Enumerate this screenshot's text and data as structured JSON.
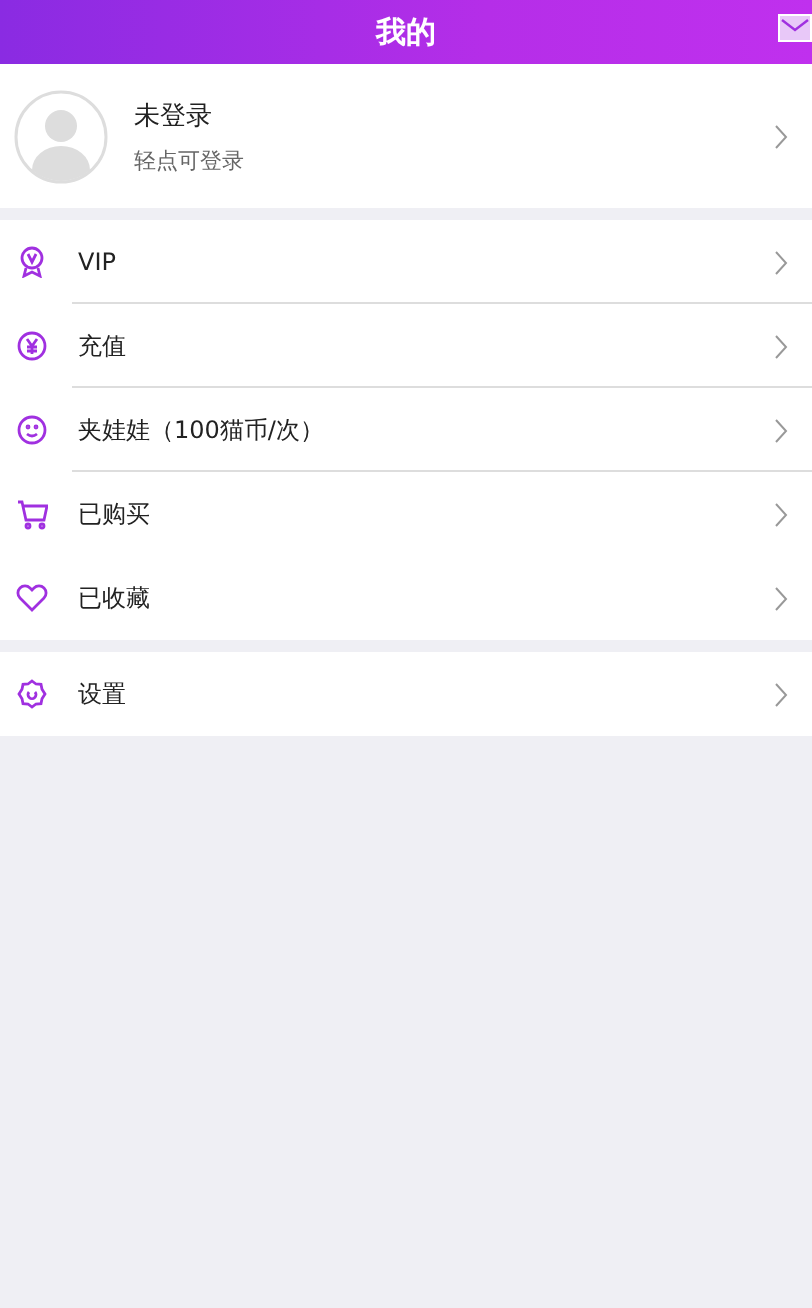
{
  "header": {
    "title": "我的"
  },
  "profile": {
    "name": "未登录",
    "hint": "轻点可登录"
  },
  "sections": [
    {
      "items": [
        {
          "label": "VIP",
          "kind": "vip",
          "divider": true
        },
        {
          "label": "充值",
          "kind": "coin",
          "divider": true
        },
        {
          "label": "夹娃娃（100猫币/次）",
          "kind": "face",
          "divider": true
        },
        {
          "label": "已购买",
          "kind": "cart",
          "divider": false
        },
        {
          "label": "已收藏",
          "kind": "heart",
          "divider": false
        }
      ]
    },
    {
      "items": [
        {
          "label": "设置",
          "kind": "gear",
          "divider": false
        }
      ]
    }
  ]
}
